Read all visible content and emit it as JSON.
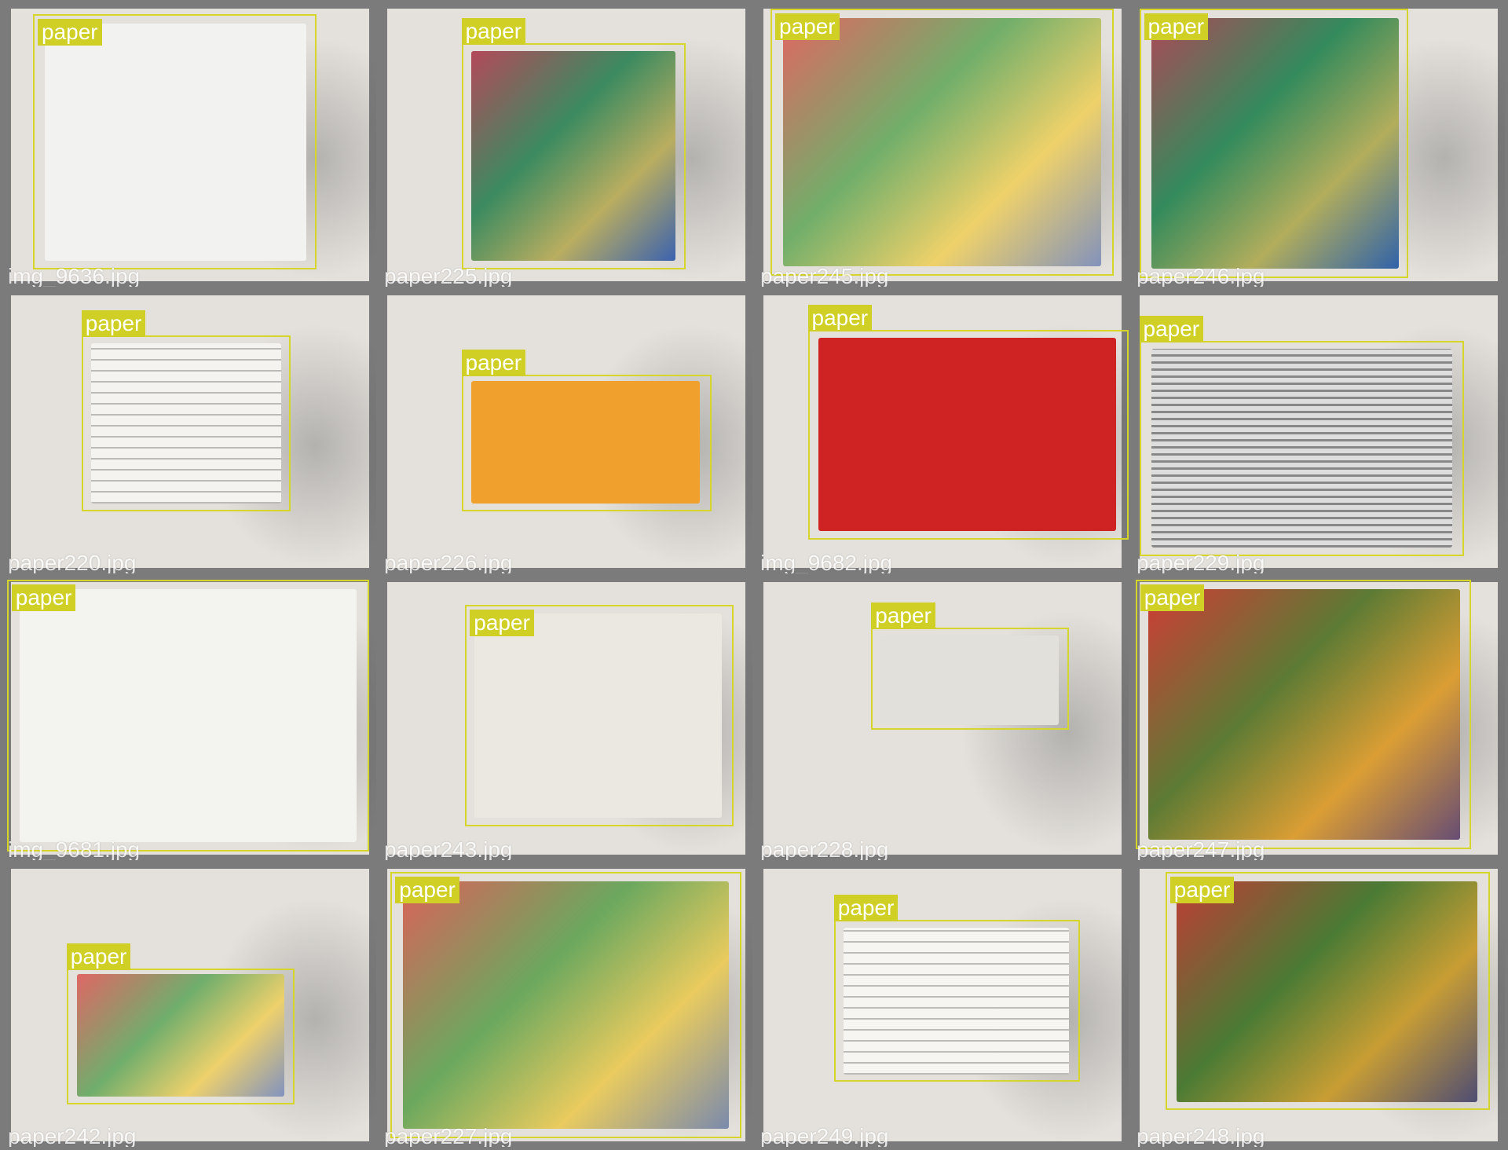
{
  "colors": {
    "box": "#d6d62a",
    "label_bg": "#cfcf25",
    "background": "#7b7b7b"
  },
  "tiles": [
    {
      "file": "img_9636.jpg",
      "label": "paper"
    },
    {
      "file": "paper225.jpg",
      "label": "paper"
    },
    {
      "file": "paper245.jpg",
      "label": "paper"
    },
    {
      "file": "paper246.jpg",
      "label": "paper"
    },
    {
      "file": "paper220.jpg",
      "label": "paper"
    },
    {
      "file": "paper226.jpg",
      "label": "paper"
    },
    {
      "file": "img_9682.jpg",
      "label": "paper"
    },
    {
      "file": "paper229.jpg",
      "label": "paper"
    },
    {
      "file": "img_9681.jpg",
      "label": "paper"
    },
    {
      "file": "paper243.jpg",
      "label": "paper"
    },
    {
      "file": "paper228.jpg",
      "label": "paper"
    },
    {
      "file": "paper247.jpg",
      "label": "paper"
    },
    {
      "file": "paper242.jpg",
      "label": "paper"
    },
    {
      "file": "paper227.jpg",
      "label": "paper"
    },
    {
      "file": "paper249.jpg",
      "label": "paper"
    },
    {
      "file": "paper248.jpg",
      "label": "paper"
    }
  ]
}
